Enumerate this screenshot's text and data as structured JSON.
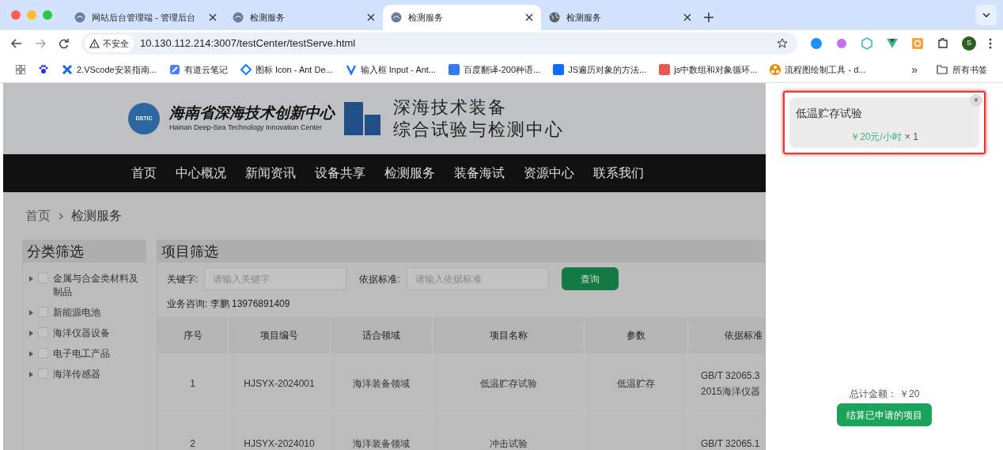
{
  "browser": {
    "tabs": [
      {
        "title": "网站后台管理端 - 管理后台",
        "selected": false
      },
      {
        "title": "检测服务",
        "selected": false
      },
      {
        "title": "检测服务",
        "selected": true
      },
      {
        "title": "检测服务",
        "selected": false
      }
    ],
    "security_label": "不安全",
    "url": "10.130.112.214:3007/testCenter/testServe.html",
    "profile_initial": "S",
    "bookmarks": [
      {
        "label": "2.VScode安装指南..."
      },
      {
        "label": "有道云笔记"
      },
      {
        "label": "图标 Icon - Ant De..."
      },
      {
        "label": "输入框 Input - Ant..."
      },
      {
        "label": "百度翻译-200种语..."
      },
      {
        "label": "JS遍历对象的方法..."
      },
      {
        "label": "js中数组和对象循环..."
      },
      {
        "label": "流程图绘制工具 - d..."
      }
    ],
    "bookmarks_more": "»",
    "all_bookmarks": "所有书签"
  },
  "site": {
    "logo_cn": "海南省深海技术创新中心",
    "logo_en": "Hainan Deep-Sea Technology Innovation Center",
    "logo_badge": "DSTIC",
    "title_lines": [
      "深海技术装备",
      "综合试验与检测中心"
    ],
    "nav": [
      {
        "label": "首页"
      },
      {
        "label": "中心概况"
      },
      {
        "label": "新闻资讯"
      },
      {
        "label": "设备共享"
      },
      {
        "label": "检测服务"
      },
      {
        "label": "装备海试"
      },
      {
        "label": "资源中心"
      },
      {
        "label": "联系我们"
      }
    ],
    "breadcrumb": [
      "首页",
      "检测服务"
    ],
    "category_filter": {
      "title": "分类筛选",
      "items": [
        {
          "label": "金属与合金类材料及制品",
          "checked": false
        },
        {
          "label": "新能源电池",
          "checked": false
        },
        {
          "label": "海洋仪器设备",
          "checked": false
        },
        {
          "label": "电子电工产品",
          "checked": false
        },
        {
          "label": "海洋传感器",
          "checked": false
        }
      ]
    },
    "project_filter": {
      "title": "项目筛选",
      "keyword_label": "关键字:",
      "keyword_placeholder": "请输入关键字",
      "standard_label": "依据标准:",
      "standard_placeholder": "请输入依据标准",
      "query_button": "查询",
      "contact": "业务咨询: 李鹏 13976891409"
    },
    "table": {
      "columns": [
        "序号",
        "项目编号",
        "适合领域",
        "项目名称",
        "参数",
        "依据标准"
      ],
      "rows": [
        [
          "1",
          "HJSYX-2024001",
          "海洋装备领域",
          "低温贮存试验",
          "低温贮存",
          [
            "GB/T 32065.3",
            "2015海洋仪器"
          ]
        ],
        [
          "2",
          "HJSYX-2024010",
          "海洋装备领域",
          "冲击试验",
          "",
          [
            "GB/T 32065.1"
          ]
        ]
      ]
    }
  },
  "cart": {
    "items": [
      {
        "name": "低温贮存试验",
        "price": "￥20元/小时",
        "quantity": "× 1",
        "close": "×"
      }
    ],
    "total": "总计金额： ￥20",
    "checkout_button": "结算已申请的项目"
  }
}
